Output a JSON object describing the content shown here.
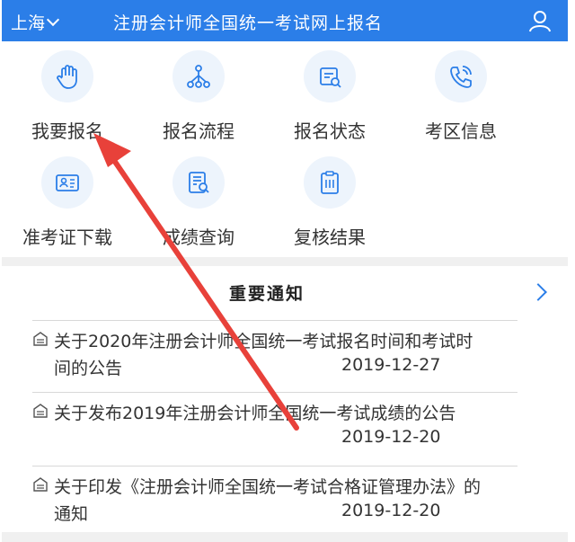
{
  "header": {
    "city": "上海",
    "title": "注册会计师全国统一考试网上报名"
  },
  "menu": [
    {
      "label": "我要报名",
      "icon": "hand-icon"
    },
    {
      "label": "报名流程",
      "icon": "flow-icon"
    },
    {
      "label": "报名状态",
      "icon": "status-icon"
    },
    {
      "label": "考区信息",
      "icon": "phone-icon"
    },
    {
      "label": "准考证下载",
      "icon": "id-card-icon"
    },
    {
      "label": "成绩查询",
      "icon": "score-search-icon"
    },
    {
      "label": "复核结果",
      "icon": "clipboard-icon"
    }
  ],
  "notices": {
    "heading": "重要通知",
    "items": [
      {
        "text": "关于2020年注册会计师全国统一考试报名时间和考试时间的公告",
        "date": "2019-12-27"
      },
      {
        "text": "关于发布2019年注册会计师全国统一考试成绩的公告",
        "date": "2019-12-20"
      },
      {
        "text": "关于印发《注册会计师全国统一考试合格证管理办法》的通知",
        "date": "2019-12-20"
      }
    ]
  },
  "colors": {
    "header_bg": "#2b7ee8",
    "icon_bg": "#edf4fc",
    "icon_stroke": "#2b7ee8",
    "annotation_arrow": "#e8413a"
  }
}
